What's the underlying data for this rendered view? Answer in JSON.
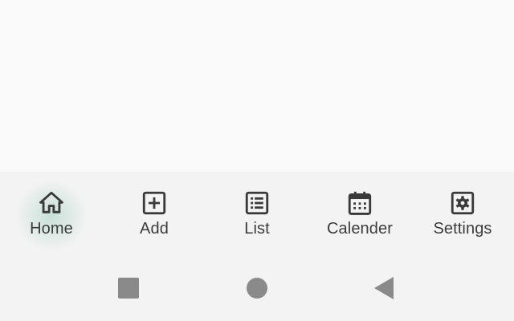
{
  "bottom_nav": {
    "items": [
      {
        "label": "Home",
        "icon": "home-icon",
        "active": true
      },
      {
        "label": "Add",
        "icon": "add-box-icon",
        "active": false
      },
      {
        "label": "List",
        "icon": "list-icon",
        "active": false
      },
      {
        "label": "Calender",
        "icon": "calendar-icon",
        "active": false
      },
      {
        "label": "Settings",
        "icon": "settings-icon",
        "active": false
      }
    ]
  },
  "system_nav": {
    "buttons": [
      "recents-square-icon",
      "home-circle-icon",
      "back-triangle-icon"
    ]
  },
  "colors": {
    "background": "#fafafa",
    "nav_background": "#f3f3f3",
    "icon": "#3a3a3a",
    "label": "#3c3c3c",
    "system_button": "#8a8a8a",
    "active_ripple": "#96c8b9"
  }
}
